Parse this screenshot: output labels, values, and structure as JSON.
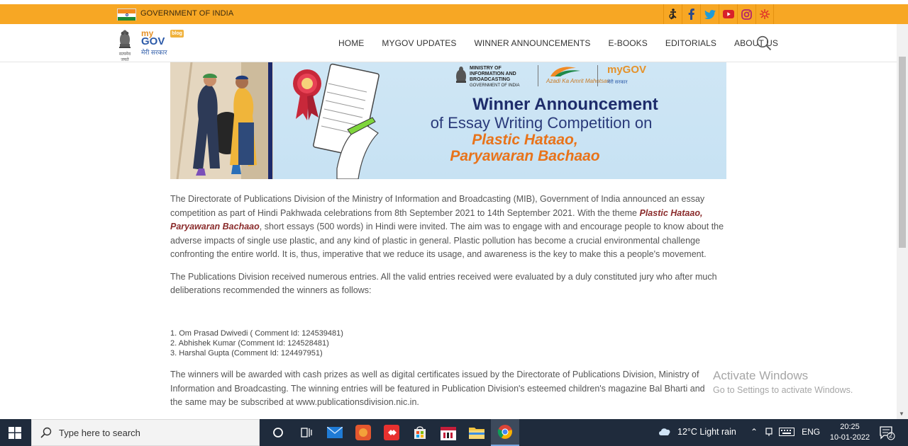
{
  "gov_bar": {
    "label": "GOVERNMENT OF INDIA",
    "social_icons": [
      "accessibility-icon",
      "facebook-icon",
      "twitter-icon",
      "youtube-icon",
      "instagram-icon",
      "koo-icon"
    ]
  },
  "header": {
    "emblem_caption": "सत्यमेव जयते",
    "logo_my": "my",
    "logo_gov": "GOV",
    "logo_badge": "blog",
    "logo_hindi": "मेरी सरकार",
    "nav": [
      "HOME",
      "MYGOV UPDATES",
      "WINNER ANNOUNCEMENTS",
      "E-BOOKS",
      "EDITORIALS",
      "ABOUT US"
    ]
  },
  "banner": {
    "ministry": "MINISTRY OF INFORMATION AND BROADCASTING",
    "ministry_sub": "GOVERNMENT OF INDIA",
    "azadi": "Azadi Ka Amrit Mahotsav",
    "mygov": "myGOV",
    "mygov_hindi": "मेरी सरकार",
    "title": "Winner Announcement",
    "subtitle": "of Essay Writing Competition on",
    "theme_line1": "Plastic Hataao,",
    "theme_line2": "Paryawaran Bachaao"
  },
  "article": {
    "p1_a": "The Directorate of Publications Division of the Ministry of Information and Broadcasting (MIB), Government of India announced an essay competition as part of Hindi Pakhwada celebrations from 8th September 2021 to 14th September 2021. With the theme ",
    "p1_theme": "Plastic Hataao, Paryawaran Bachaao",
    "p1_b": ", short essays (500 words) in Hindi were invited. The aim was to engage with and encourage people to know about the adverse impacts of single use plastic, and any kind of plastic in general. Plastic pollution has become a crucial environmental challenge confronting the entire world. It is, thus, imperative that we reduce its usage, and awareness is the key to make this a people's movement.",
    "p2": "The Publications Division received numerous entries. All the valid entries received were evaluated by a duly constituted jury who after much deliberations recommended the winners as follows:",
    "winners": [
      "1. Om Prasad Dwivedi ( Comment Id: 124539481)",
      "2. Abhishek Kumar (Comment Id: 124528481)",
      "3. Harshal Gupta (Comment Id: 124497951)"
    ],
    "p3_a": "The winners will be awarded with cash prizes as well as digital certificates issued by the Directorate of Publications Division, Ministry of Information and Broadcasting. The winning entries will be featured in Publication Division's esteemed children's magazine ",
    "p3_mag": "Bal Bharti",
    "p3_b": " and the same may be subscribed at www.publicationsdivision.nic.in."
  },
  "watermark": {
    "line1": "Activate Windows",
    "line2": "Go to Settings to activate Windows."
  },
  "taskbar": {
    "search_placeholder": "Type here to search",
    "weather": "12°C  Light rain",
    "lang": "ENG",
    "time": "20:25",
    "date": "10-01-2022",
    "notifications": "2"
  }
}
